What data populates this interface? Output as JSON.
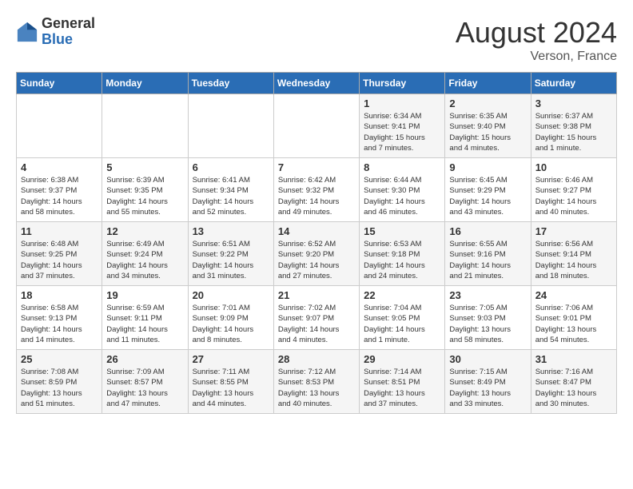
{
  "header": {
    "logo_general": "General",
    "logo_blue": "Blue",
    "month_year": "August 2024",
    "location": "Verson, France"
  },
  "days_of_week": [
    "Sunday",
    "Monday",
    "Tuesday",
    "Wednesday",
    "Thursday",
    "Friday",
    "Saturday"
  ],
  "weeks": [
    [
      {
        "day": "",
        "info": ""
      },
      {
        "day": "",
        "info": ""
      },
      {
        "day": "",
        "info": ""
      },
      {
        "day": "",
        "info": ""
      },
      {
        "day": "1",
        "info": "Sunrise: 6:34 AM\nSunset: 9:41 PM\nDaylight: 15 hours\nand 7 minutes."
      },
      {
        "day": "2",
        "info": "Sunrise: 6:35 AM\nSunset: 9:40 PM\nDaylight: 15 hours\nand 4 minutes."
      },
      {
        "day": "3",
        "info": "Sunrise: 6:37 AM\nSunset: 9:38 PM\nDaylight: 15 hours\nand 1 minute."
      }
    ],
    [
      {
        "day": "4",
        "info": "Sunrise: 6:38 AM\nSunset: 9:37 PM\nDaylight: 14 hours\nand 58 minutes."
      },
      {
        "day": "5",
        "info": "Sunrise: 6:39 AM\nSunset: 9:35 PM\nDaylight: 14 hours\nand 55 minutes."
      },
      {
        "day": "6",
        "info": "Sunrise: 6:41 AM\nSunset: 9:34 PM\nDaylight: 14 hours\nand 52 minutes."
      },
      {
        "day": "7",
        "info": "Sunrise: 6:42 AM\nSunset: 9:32 PM\nDaylight: 14 hours\nand 49 minutes."
      },
      {
        "day": "8",
        "info": "Sunrise: 6:44 AM\nSunset: 9:30 PM\nDaylight: 14 hours\nand 46 minutes."
      },
      {
        "day": "9",
        "info": "Sunrise: 6:45 AM\nSunset: 9:29 PM\nDaylight: 14 hours\nand 43 minutes."
      },
      {
        "day": "10",
        "info": "Sunrise: 6:46 AM\nSunset: 9:27 PM\nDaylight: 14 hours\nand 40 minutes."
      }
    ],
    [
      {
        "day": "11",
        "info": "Sunrise: 6:48 AM\nSunset: 9:25 PM\nDaylight: 14 hours\nand 37 minutes."
      },
      {
        "day": "12",
        "info": "Sunrise: 6:49 AM\nSunset: 9:24 PM\nDaylight: 14 hours\nand 34 minutes."
      },
      {
        "day": "13",
        "info": "Sunrise: 6:51 AM\nSunset: 9:22 PM\nDaylight: 14 hours\nand 31 minutes."
      },
      {
        "day": "14",
        "info": "Sunrise: 6:52 AM\nSunset: 9:20 PM\nDaylight: 14 hours\nand 27 minutes."
      },
      {
        "day": "15",
        "info": "Sunrise: 6:53 AM\nSunset: 9:18 PM\nDaylight: 14 hours\nand 24 minutes."
      },
      {
        "day": "16",
        "info": "Sunrise: 6:55 AM\nSunset: 9:16 PM\nDaylight: 14 hours\nand 21 minutes."
      },
      {
        "day": "17",
        "info": "Sunrise: 6:56 AM\nSunset: 9:14 PM\nDaylight: 14 hours\nand 18 minutes."
      }
    ],
    [
      {
        "day": "18",
        "info": "Sunrise: 6:58 AM\nSunset: 9:13 PM\nDaylight: 14 hours\nand 14 minutes."
      },
      {
        "day": "19",
        "info": "Sunrise: 6:59 AM\nSunset: 9:11 PM\nDaylight: 14 hours\nand 11 minutes."
      },
      {
        "day": "20",
        "info": "Sunrise: 7:01 AM\nSunset: 9:09 PM\nDaylight: 14 hours\nand 8 minutes."
      },
      {
        "day": "21",
        "info": "Sunrise: 7:02 AM\nSunset: 9:07 PM\nDaylight: 14 hours\nand 4 minutes."
      },
      {
        "day": "22",
        "info": "Sunrise: 7:04 AM\nSunset: 9:05 PM\nDaylight: 14 hours\nand 1 minute."
      },
      {
        "day": "23",
        "info": "Sunrise: 7:05 AM\nSunset: 9:03 PM\nDaylight: 13 hours\nand 58 minutes."
      },
      {
        "day": "24",
        "info": "Sunrise: 7:06 AM\nSunset: 9:01 PM\nDaylight: 13 hours\nand 54 minutes."
      }
    ],
    [
      {
        "day": "25",
        "info": "Sunrise: 7:08 AM\nSunset: 8:59 PM\nDaylight: 13 hours\nand 51 minutes."
      },
      {
        "day": "26",
        "info": "Sunrise: 7:09 AM\nSunset: 8:57 PM\nDaylight: 13 hours\nand 47 minutes."
      },
      {
        "day": "27",
        "info": "Sunrise: 7:11 AM\nSunset: 8:55 PM\nDaylight: 13 hours\nand 44 minutes."
      },
      {
        "day": "28",
        "info": "Sunrise: 7:12 AM\nSunset: 8:53 PM\nDaylight: 13 hours\nand 40 minutes."
      },
      {
        "day": "29",
        "info": "Sunrise: 7:14 AM\nSunset: 8:51 PM\nDaylight: 13 hours\nand 37 minutes."
      },
      {
        "day": "30",
        "info": "Sunrise: 7:15 AM\nSunset: 8:49 PM\nDaylight: 13 hours\nand 33 minutes."
      },
      {
        "day": "31",
        "info": "Sunrise: 7:16 AM\nSunset: 8:47 PM\nDaylight: 13 hours\nand 30 minutes."
      }
    ]
  ]
}
